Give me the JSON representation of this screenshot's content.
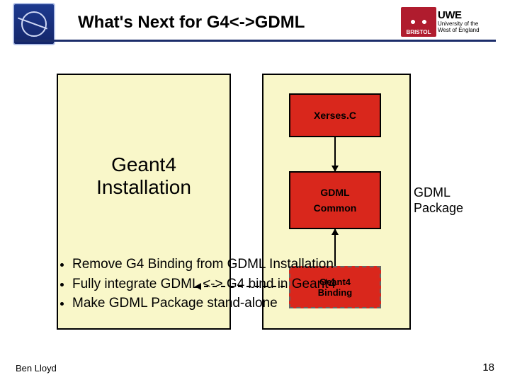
{
  "header": {
    "title": "What's Next for G4<->GDML",
    "logo_left_name": "cern-logo",
    "logo_right1_text": "BRISTOL",
    "logo_right2_line1": "University of the",
    "logo_right2_line2": "West of England",
    "logo_right2_big": "UWE"
  },
  "diagram": {
    "left_box_label": "Geant4\nInstallation",
    "nodes": {
      "xerses": "Xerses.C",
      "gdml_line1": "GDML",
      "gdml_line2": "Common",
      "g4b_line1": "Geant4",
      "g4b_line2": "Binding"
    },
    "right_label_line1": "GDML",
    "right_label_line2": "Package"
  },
  "bullets": [
    "Remove G4 Binding from GDML Installation",
    "Fully integrate GDML <-> G4 bind in Geant4",
    "Make GDML Package stand-alone"
  ],
  "footer": {
    "author": "Ben Lloyd",
    "page": "18"
  }
}
